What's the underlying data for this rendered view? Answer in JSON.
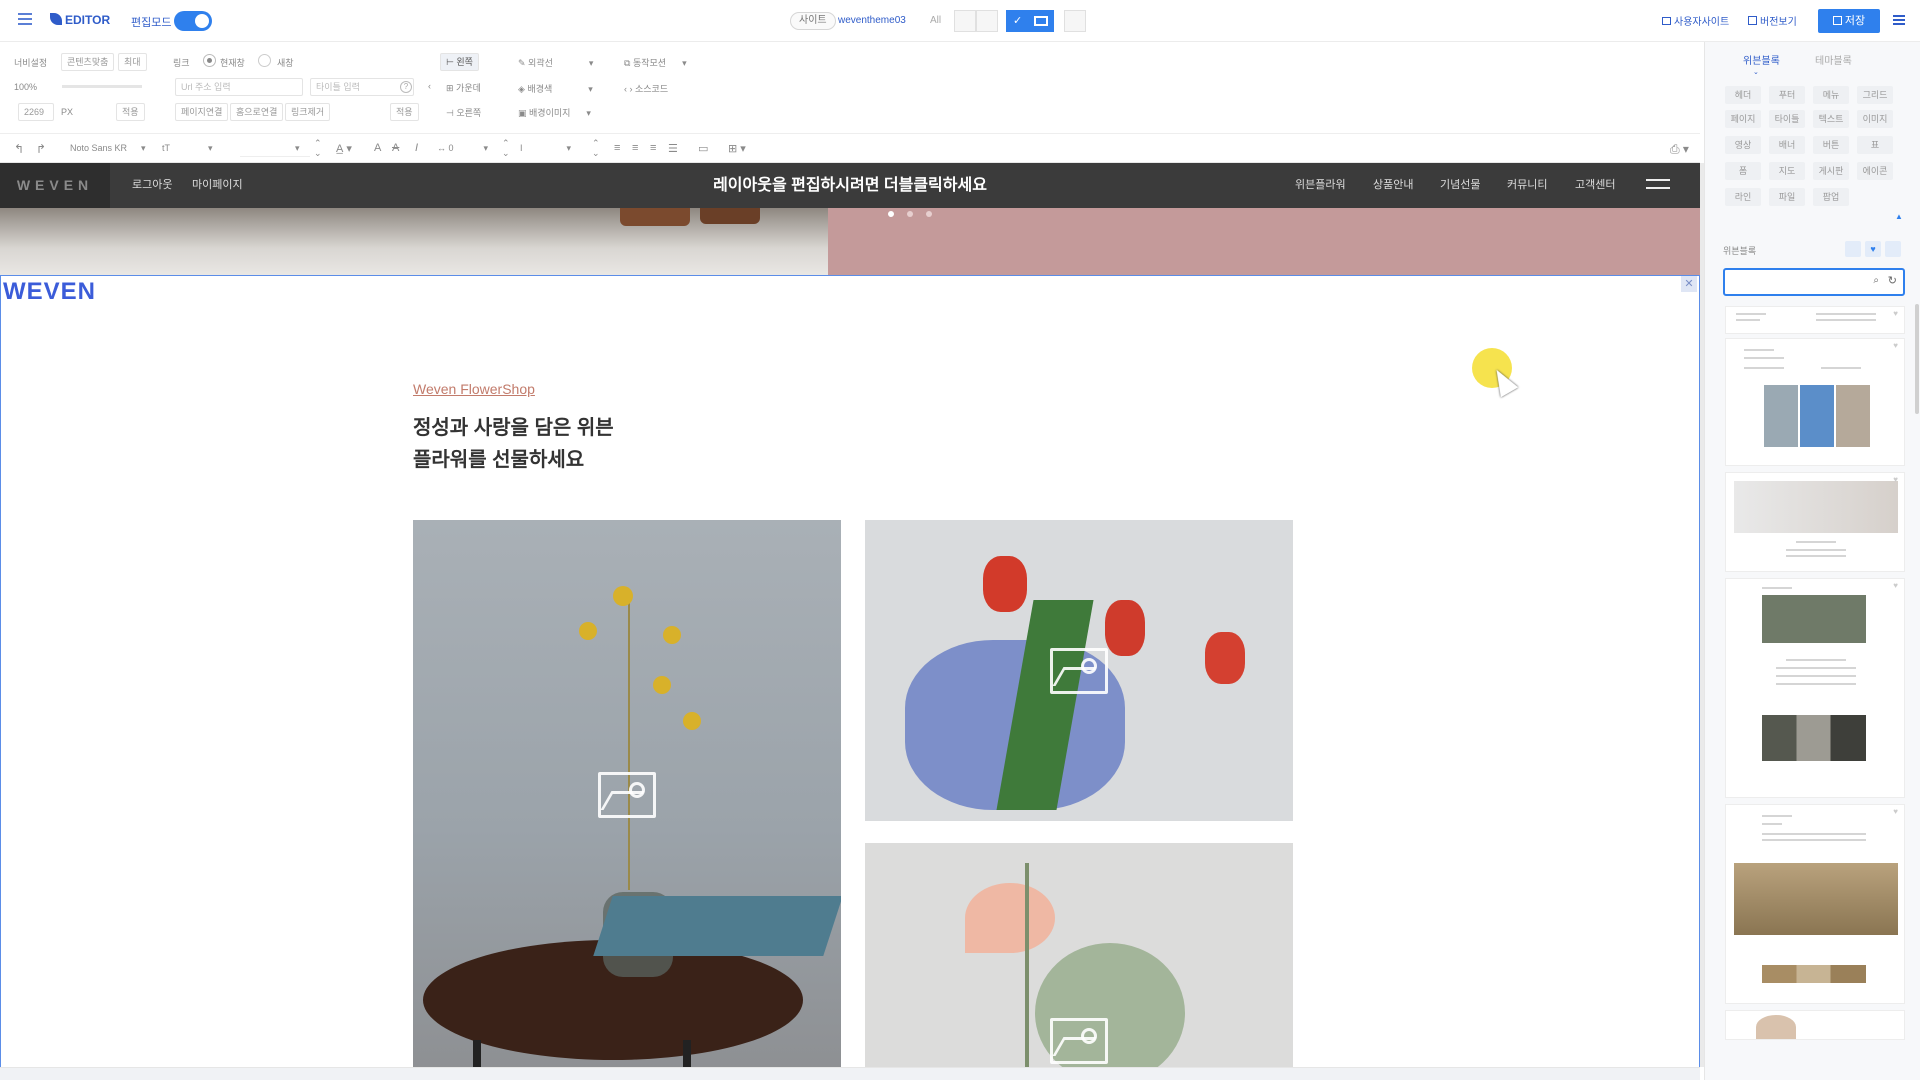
{
  "topbar": {
    "menu_icon": "hamburger-icon",
    "logo": "EDITOR",
    "edit_mode_label": "편집모드",
    "site_label": "사이트",
    "site_name": "weventheme03",
    "all_label": "All",
    "user_site": "사용자사이트",
    "version_view": "버전보기",
    "save": "저장"
  },
  "props": {
    "width_label": "너비설정",
    "content_fit": "콘텐츠맞춤",
    "max": "최대",
    "percent": "100%",
    "px_value": "2269",
    "px_unit": "PX",
    "apply": "적용",
    "link_label": "링크",
    "current_window": "현재창",
    "new_window": "새창",
    "url_placeholder": "Url 주소 입력",
    "title_placeholder": "타이틀 입력",
    "page_link": "페이지연결",
    "home_link": "홈으로연결",
    "link_remove": "링크제거",
    "apply2": "적용",
    "align_left": "왼쪽",
    "align_center": "가운데",
    "align_right": "오른쪽",
    "outline": "외곽선",
    "bg_color": "배경색",
    "bg_image": "배경이미지",
    "motion": "동작모션",
    "source": "소스코드"
  },
  "toolbar": {
    "font": "Noto Sans KR",
    "size_placeholder": "tT",
    "letter_value": "0"
  },
  "canvas": {
    "nav": {
      "logo": "WEVEN",
      "logout": "로그아웃",
      "mypage": "마이페이지",
      "hint": "레이아웃을 편집하시려면 더블클릭하세요",
      "items": [
        "위븐플라워",
        "상품안내",
        "기념선물",
        "커뮤니티",
        "고객센터"
      ]
    },
    "section": {
      "logo": "WEVEN",
      "eyebrow": "Weven FlowerShop",
      "headline": "정성과 사랑을 담은 위븐\n플라워를 선물하세요"
    }
  },
  "rpanel": {
    "tab_blocks": "위븐블록",
    "tab_theme": "테마블록",
    "categories": [
      "헤더",
      "푸터",
      "메뉴",
      "그리드",
      "페이지",
      "타이틀",
      "텍스트",
      "이미지",
      "영상",
      "배너",
      "버튼",
      "표",
      "폼",
      "지도",
      "게시판",
      "에이콘",
      "라인",
      "파일",
      "팝업"
    ],
    "section_label": "위븐블록"
  },
  "colors": {
    "accent": "#2f80ed",
    "nav_bg": "#3b3b3b",
    "brand_blue": "#3b5cd9",
    "eyebrow": "#c27b6b"
  }
}
